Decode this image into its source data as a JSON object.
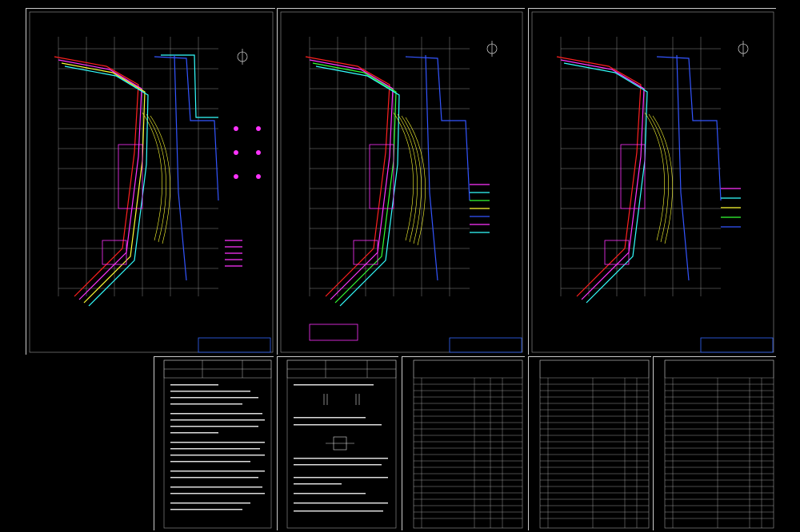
{
  "sheets": [
    {
      "id": "plan-1"
    },
    {
      "id": "plan-2"
    },
    {
      "id": "plan-3"
    },
    {
      "id": "notes-1"
    },
    {
      "id": "notes-2"
    },
    {
      "id": "table-1"
    },
    {
      "id": "table-2"
    },
    {
      "id": "table-3"
    }
  ],
  "colors": {
    "background": "#000000",
    "frame": "#cccccc",
    "grid": "#bbbbbb",
    "road_red": "#ff2020",
    "road_magenta": "#ff33ff",
    "road_yellow": "#ffff33",
    "road_cyan": "#33ffff",
    "road_green": "#33ff33",
    "road_blue": "#3355ff",
    "titleblock": "#3366ff"
  },
  "icons": [
    "north-arrow-icon"
  ]
}
